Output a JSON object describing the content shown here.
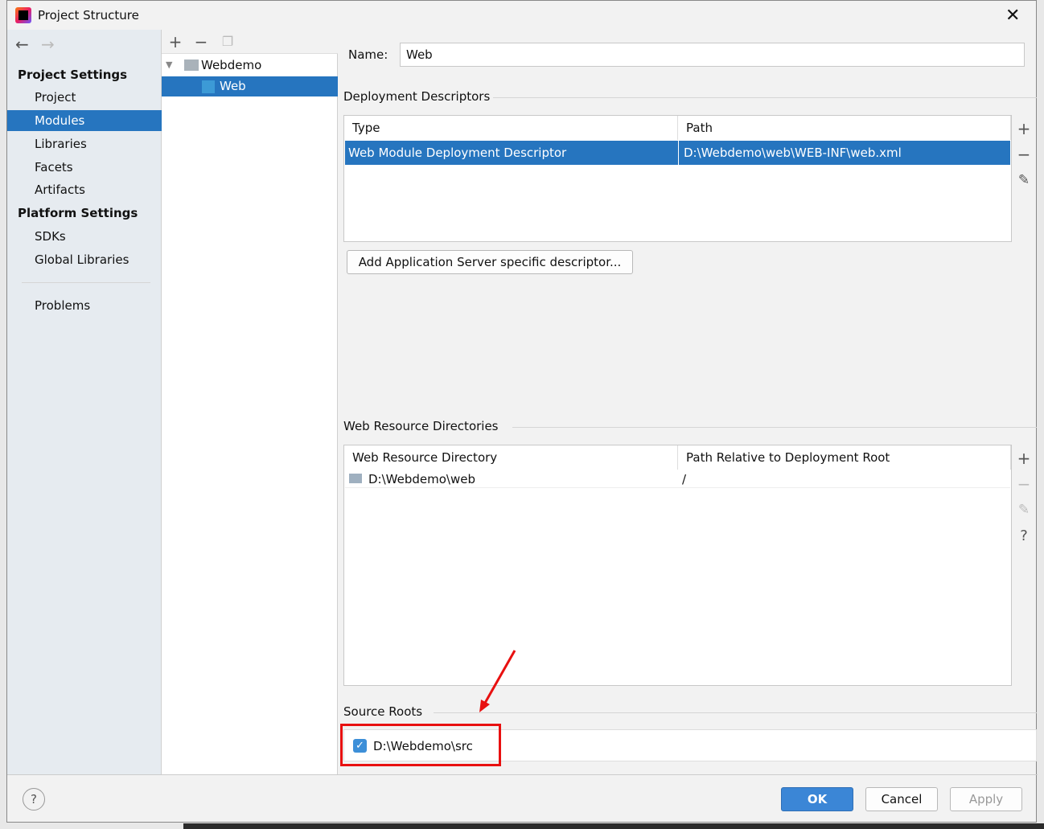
{
  "window": {
    "title": "Project Structure"
  },
  "nav": {
    "back": "←",
    "forward": "→",
    "project_settings": "Project Settings",
    "items": [
      "Project",
      "Modules",
      "Libraries",
      "Facets",
      "Artifacts"
    ],
    "platform_settings": "Platform Settings",
    "platform_items": [
      "SDKs",
      "Global Libraries"
    ],
    "problems": "Problems"
  },
  "tree": {
    "add": "+",
    "remove": "−",
    "root": "Webdemo",
    "child": "Web"
  },
  "name": {
    "label": "Name:",
    "value": "Web"
  },
  "deployment": {
    "title": "Deployment Descriptors",
    "columns": [
      "Type",
      "Path"
    ],
    "rows": [
      [
        "Web Module Deployment Descriptor",
        "D:\\Webdemo\\web\\WEB-INF\\web.xml"
      ]
    ],
    "add_button": "Add Application Server specific descriptor..."
  },
  "resources": {
    "title": "Web Resource Directories",
    "columns": [
      "Web Resource Directory",
      "Path Relative to Deployment Root"
    ],
    "rows": [
      [
        "D:\\Webdemo\\web",
        "/"
      ]
    ],
    "help": "?"
  },
  "source_roots": {
    "title": "Source Roots",
    "items": [
      {
        "path": "D:\\Webdemo\\src",
        "checked": true
      }
    ]
  },
  "footer": {
    "help": "?",
    "ok": "OK",
    "cancel": "Cancel",
    "apply": "Apply"
  },
  "colors": {
    "selection": "#2675bf",
    "annotation": "#e81010"
  }
}
